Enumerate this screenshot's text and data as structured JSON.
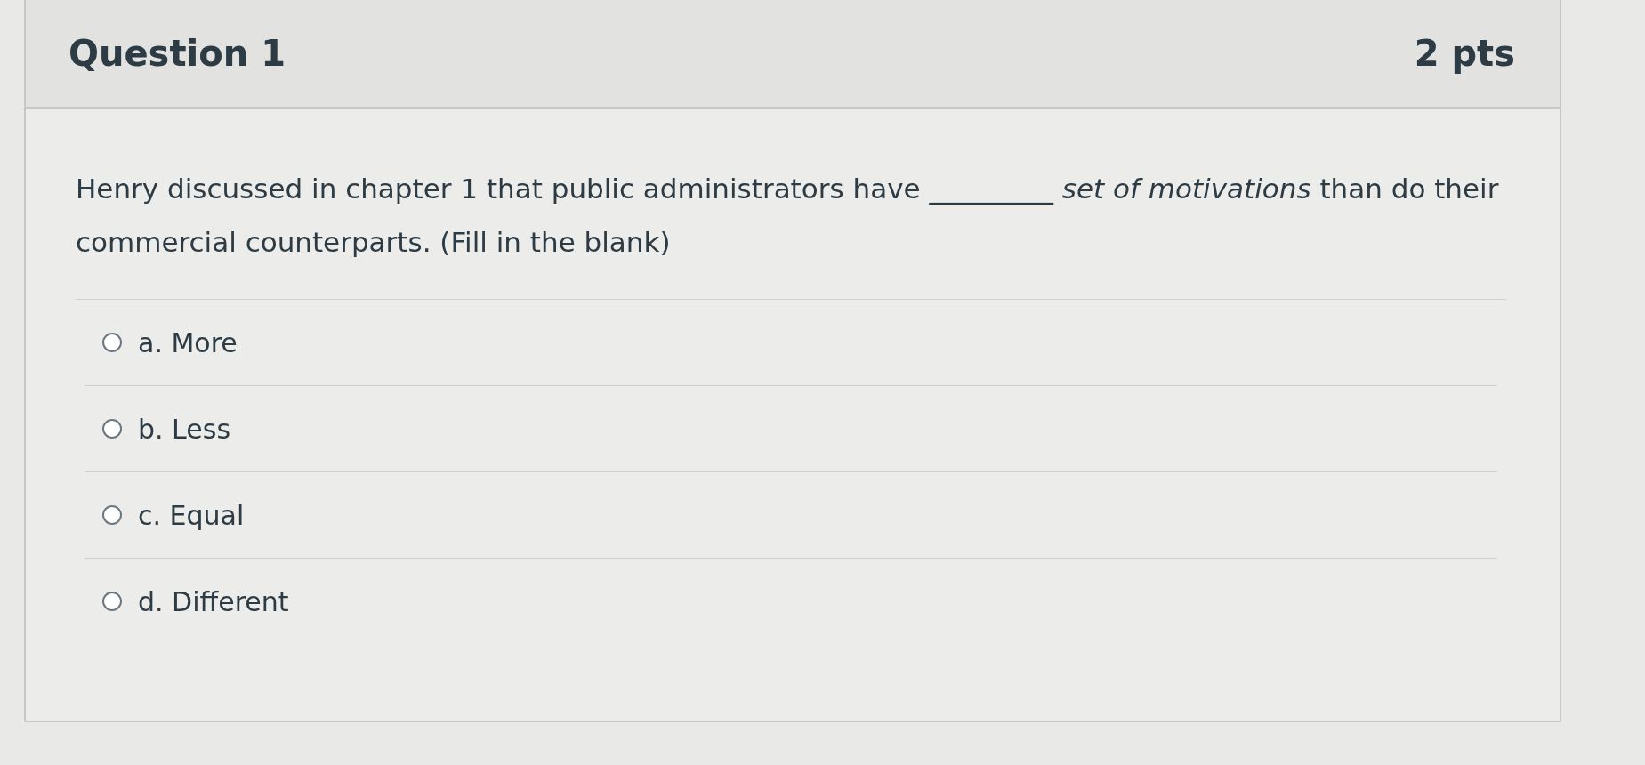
{
  "question": {
    "title": "Question 1",
    "points": "2 pts",
    "text": "Henry discussed in chapter 1 that public administrators have  _________  *set of motivations* than do their commercial counterparts. (Fill in the blank)",
    "options": [
      {
        "label": "a. More",
        "selected": false
      },
      {
        "label": "b. Less",
        "selected": false
      },
      {
        "label": "c. Equal",
        "selected": false
      },
      {
        "label": "d. Different",
        "selected": false
      }
    ]
  }
}
